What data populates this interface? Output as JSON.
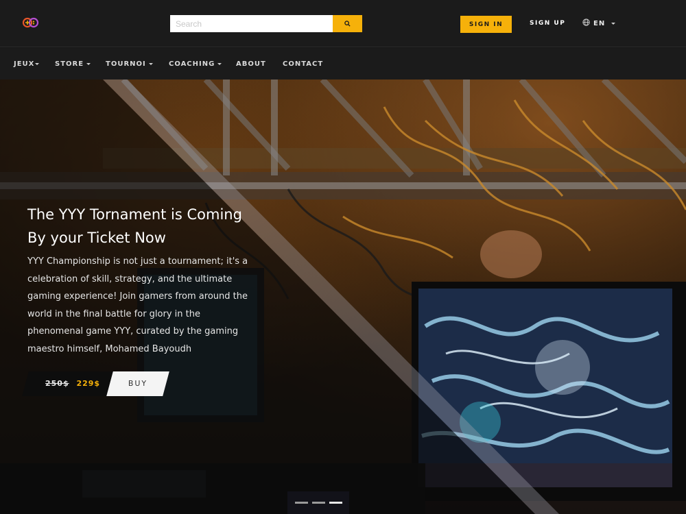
{
  "header": {
    "search_placeholder": "Search",
    "sign_in": "SIGN IN",
    "sign_up": "SIGN UP",
    "language": "EN"
  },
  "nav": {
    "items": [
      {
        "label": "JEUX"
      },
      {
        "label": "STORE"
      },
      {
        "label": "TOURNOI"
      },
      {
        "label": "COACHING"
      },
      {
        "label": "ABOUT"
      },
      {
        "label": "CONTACT"
      }
    ]
  },
  "hero": {
    "title": "The YYY Tornament is Coming By your Ticket Now",
    "description": "YYY Championship is not just a tournament; it's a celebration of skill, strategy, and the ultimate gaming experience! Join gamers from around the world in the final battle for glory in the phenomenal game YYY, curated by the gaming maestro himself, Mohamed Bayoudh",
    "old_price": "250$",
    "new_price": "229$",
    "buy_label": "BUY"
  },
  "slider": {
    "slide_count": 3,
    "active_slide": 3
  },
  "colors": {
    "accent": "#f6b10a",
    "header_bg": "#1b1b1b"
  },
  "icons": [
    "logo-icon",
    "search-icon",
    "globe-icon",
    "caret-down-icon"
  ]
}
